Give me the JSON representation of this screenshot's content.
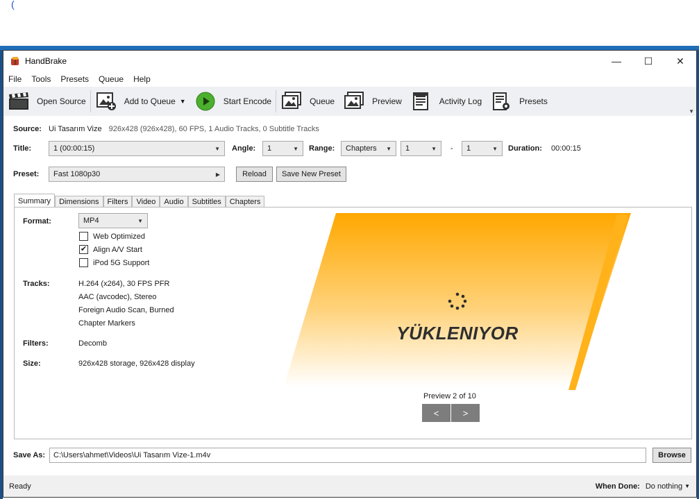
{
  "window": {
    "title": "HandBrake",
    "controls": {
      "minimize": "—",
      "maximize": "☐",
      "close": "✕"
    }
  },
  "menu": [
    "File",
    "Tools",
    "Presets",
    "Queue",
    "Help"
  ],
  "toolbar": {
    "open_source": "Open Source",
    "add_to_queue": "Add to Queue",
    "start_encode": "Start Encode",
    "queue": "Queue",
    "preview": "Preview",
    "activity_log": "Activity Log",
    "presets": "Presets"
  },
  "source": {
    "label": "Source:",
    "name": "Ui Tasarım Vize",
    "info": "926x428 (926x428), 60 FPS, 1 Audio Tracks, 0 Subtitle Tracks"
  },
  "title_row": {
    "title_label": "Title:",
    "title_value": "1  (00:00:15)",
    "angle_label": "Angle:",
    "angle_value": "1",
    "range_label": "Range:",
    "range_mode": "Chapters",
    "range_start": "1",
    "range_sep": "-",
    "range_end": "1",
    "duration_label": "Duration:",
    "duration_value": "00:00:15"
  },
  "preset": {
    "label": "Preset:",
    "value": "Fast 1080p30",
    "reload": "Reload",
    "save_new": "Save New Preset"
  },
  "tabs": [
    "Summary",
    "Dimensions",
    "Filters",
    "Video",
    "Audio",
    "Subtitles",
    "Chapters"
  ],
  "summary": {
    "format_label": "Format:",
    "format_value": "MP4",
    "options": [
      {
        "label": "Web Optimized",
        "checked": false
      },
      {
        "label": "Align A/V Start",
        "checked": true
      },
      {
        "label": "iPod 5G Support",
        "checked": false
      }
    ],
    "tracks_label": "Tracks:",
    "tracks": [
      "H.264 (x264), 30 FPS PFR",
      "AAC (avcodec), Stereo",
      "Foreign Audio Scan, Burned",
      "Chapter Markers"
    ],
    "filters_label": "Filters:",
    "filters_value": "Decomb",
    "size_label": "Size:",
    "size_value": "926x428 storage, 926x428 display"
  },
  "preview": {
    "loading_text": "YÜKLENIYOR",
    "counter": "Preview 2 of 10",
    "prev": "<",
    "next": ">"
  },
  "save_as": {
    "label": "Save As:",
    "path": "C:\\Users\\ahmet\\Videos\\Ui Tasarım Vize-1.m4v",
    "browse": "Browse"
  },
  "status": {
    "text": "Ready",
    "when_done_label": "When Done:",
    "when_done_value": "Do nothing"
  },
  "colors": {
    "preview_orange": "#ffa800",
    "start_green": "#4caf2e",
    "nav_button": "#7d7d7d"
  }
}
